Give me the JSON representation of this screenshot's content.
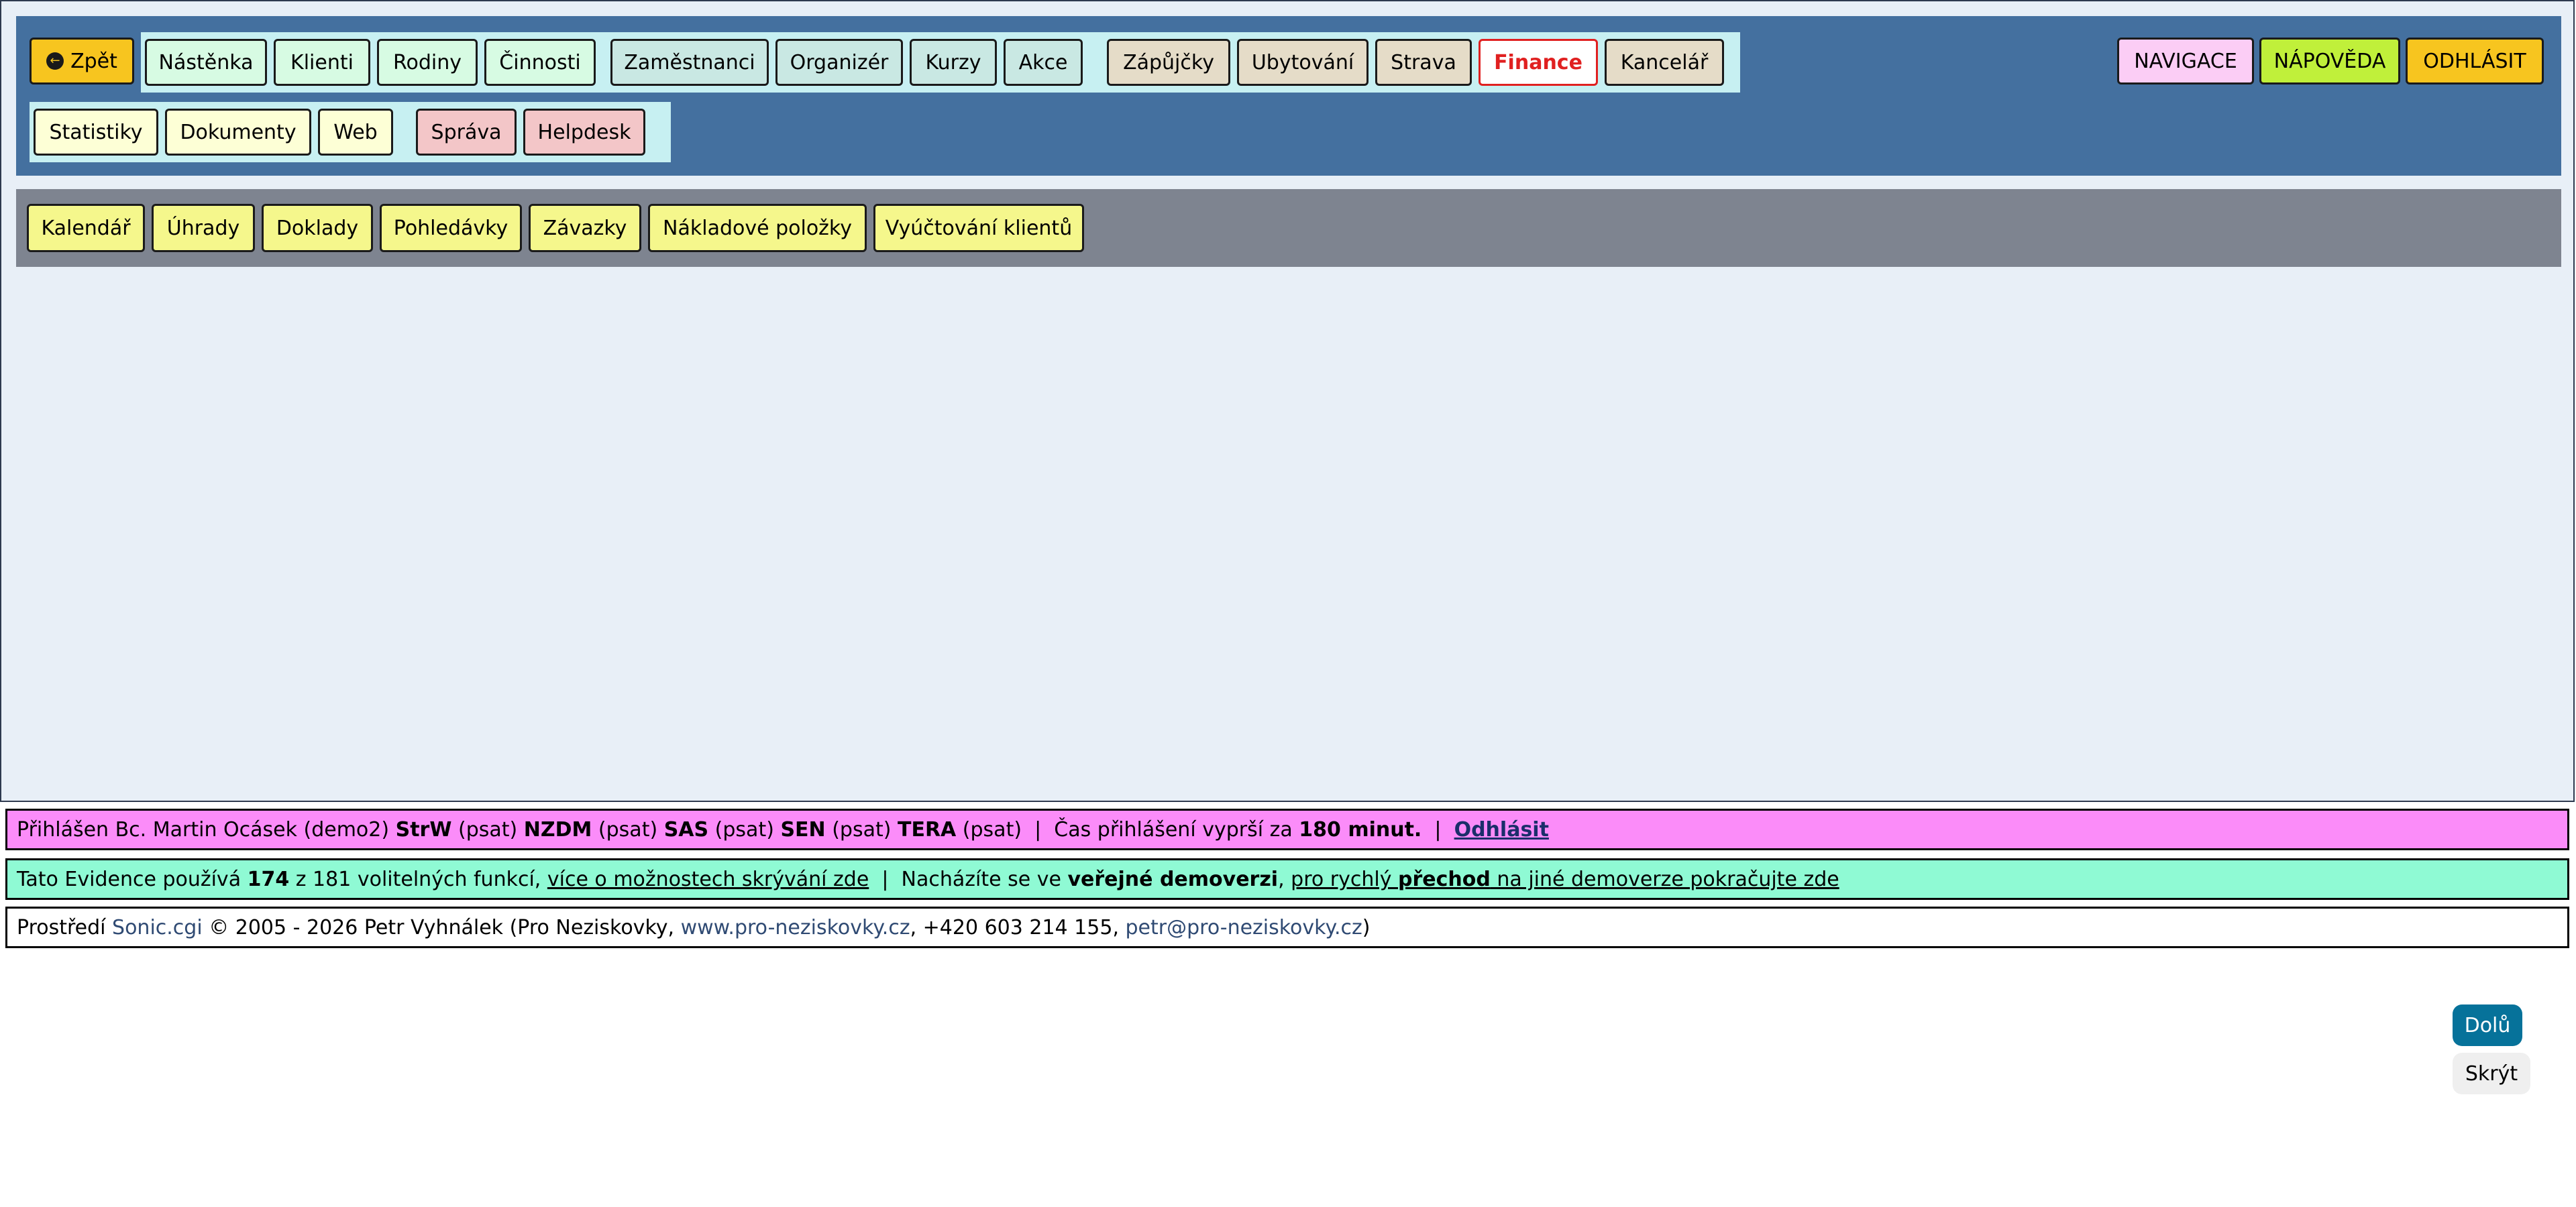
{
  "topnav": {
    "back_label": "Zpět",
    "group1": [
      "Nástěnka",
      "Klienti",
      "Rodiny",
      "Činnosti"
    ],
    "group2": [
      "Zaměstnanci",
      "Organizér",
      "Kurzy",
      "Akce"
    ],
    "group3": [
      "Zápůjčky",
      "Ubytování",
      "Strava",
      "Finance",
      "Kancelář"
    ],
    "active": "Finance",
    "row2_group1": [
      "Statistiky",
      "Dokumenty",
      "Web"
    ],
    "row2_group2": [
      "Správa",
      "Helpdesk"
    ],
    "right": [
      "NAVIGACE",
      "NÁPOVĚDA",
      "ODHLÁSIT"
    ]
  },
  "subnav": [
    "Kalendář",
    "Úhrady",
    "Doklady",
    "Pohledávky",
    "Závazky",
    "Nákladové položky",
    "Vyúčtování klientů"
  ],
  "login_bar": {
    "prefix": "Přihlášen Bc. Martin Ocásek (demo2) ",
    "s1": "StrW",
    "p1": " (psat) ",
    "s2": "NZDM",
    "p2": " (psat) ",
    "s3": "SAS",
    "p3": " (psat) ",
    "s4": "SEN",
    "p4": " (psat) ",
    "s5": "TERA",
    "p5": " (psat)  |  Čas přihlášení vyprší za ",
    "minutes": "180 minut.",
    "sep": "  |  ",
    "logout": "Odhlásit"
  },
  "info_bar": {
    "t1": "Tato Evidence používá ",
    "used": "174",
    "t2": " z 181 volitelných funkcí, ",
    "link1": "více o možnostech skrývání zde",
    "t3": "  |  Nacházíte se ve ",
    "demo": "veřejné demoverzi",
    "t4": ", ",
    "link2a": "pro rychlý ",
    "link2b": "přechod",
    "link2c": " na jiné demoverze pokračujte zde"
  },
  "footer_bar": {
    "t1": "Prostředí ",
    "product": "Sonic.cgi",
    "t2": " © 2005 - 2026 Petr Vyhnálek (Pro Neziskovky, ",
    "web": "www.pro-neziskovky.cz",
    "t3": ", +420 603 214 155, ",
    "email": "petr@pro-neziskovky.cz",
    "t4": ")"
  },
  "float_buttons": {
    "down": "Dolů",
    "hide": "Skrýt"
  },
  "icons": {
    "back": "arrow-left-circle-icon"
  },
  "colors": {
    "nav_bg": "#44709f",
    "subnav_bg": "#7e8490",
    "active": "#e02020",
    "login_bar": "#fb8cf9",
    "info_bar": "#8ffad4"
  }
}
